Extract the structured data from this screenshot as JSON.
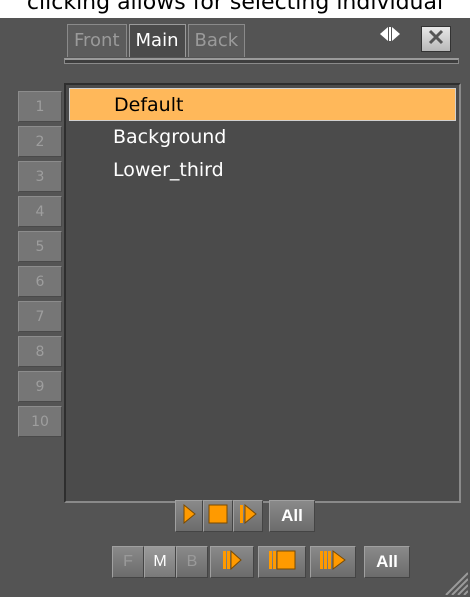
{
  "caption": "clicking allows for selecting individual",
  "tabs": [
    {
      "label": "Front",
      "active": false
    },
    {
      "label": "Main",
      "active": true
    },
    {
      "label": "Back",
      "active": false
    }
  ],
  "layer_numbers": [
    "1",
    "2",
    "3",
    "4",
    "5",
    "6",
    "7",
    "8",
    "9",
    "10"
  ],
  "list_items": [
    {
      "label": "Default",
      "selected": true
    },
    {
      "label": "Background",
      "selected": false
    },
    {
      "label": "Lower_third",
      "selected": false
    }
  ],
  "controls": {
    "all_label_top": "All",
    "all_label_bottom": "All",
    "f_label": "F",
    "m_label": "M",
    "b_label": "B"
  },
  "colors": {
    "accent": "#ffb85a",
    "icon_orange": "#ff9a00"
  },
  "icons": [
    "split-view-icon",
    "close-icon",
    "play-icon",
    "stop-icon",
    "continue-icon",
    "resize-grip-icon"
  ]
}
